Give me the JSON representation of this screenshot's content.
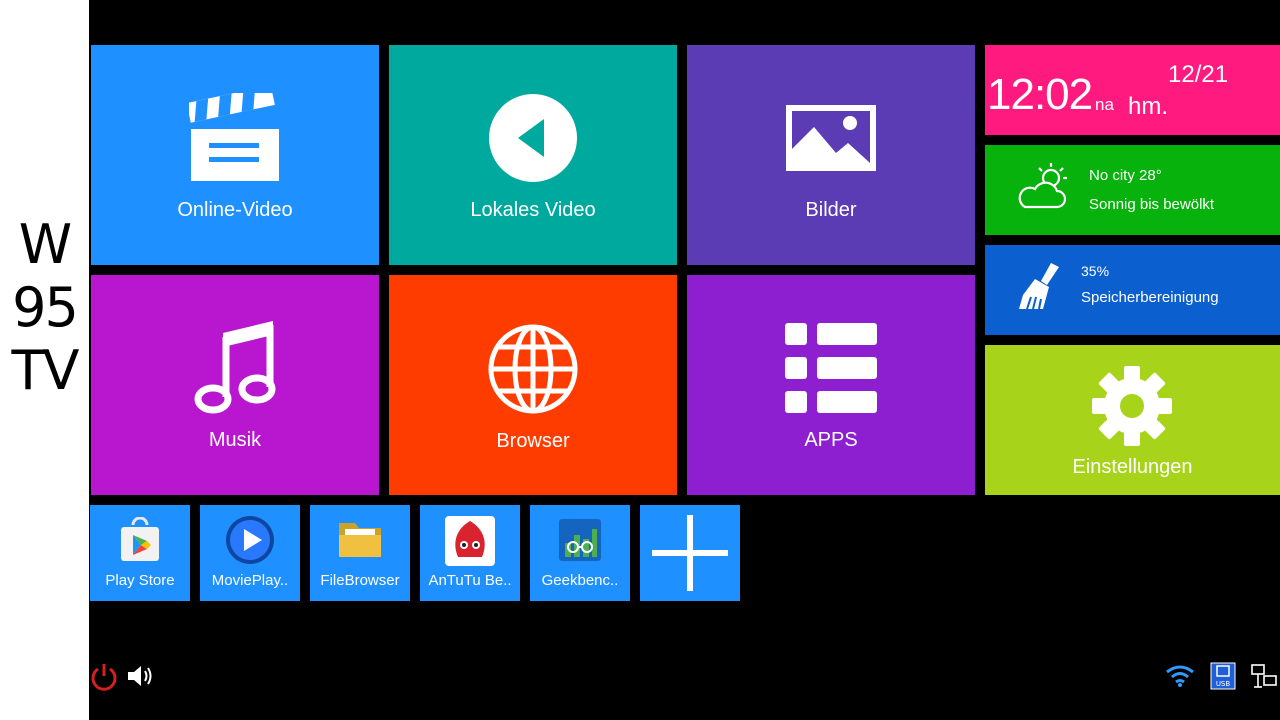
{
  "sidebar": {
    "line1": "W",
    "line2": "95",
    "line3": "TV"
  },
  "tiles": {
    "online_video": {
      "label": "Online-Video",
      "color": "#1e90ff"
    },
    "local_video": {
      "label": "Lokales Video",
      "color": "#00a99d"
    },
    "pictures": {
      "label": "Bilder",
      "color": "#5c3cb5"
    },
    "music": {
      "label": "Musik",
      "color": "#b817cf"
    },
    "browser": {
      "label": "Browser",
      "color": "#ff3c00"
    },
    "apps": {
      "label": "APPS",
      "color": "#8e1fd0"
    },
    "settings": {
      "label": "Einstellungen",
      "color": "#a7d41a"
    }
  },
  "clock": {
    "time": "12:02",
    "suffix": "na",
    "date": "12/21",
    "day": "hm.",
    "color": "#ff1a7f"
  },
  "weather": {
    "city_temp": "No city  28°",
    "condition": "Sonnig bis bewölkt",
    "color": "#07b20d"
  },
  "memory": {
    "percent": "35%",
    "label": "Speicherbereinigung",
    "color": "#0b5fcf"
  },
  "shortcuts": [
    {
      "label": "Play Store"
    },
    {
      "label": "MoviePlay.."
    },
    {
      "label": "FileBrowser"
    },
    {
      "label": "AnTuTu Be.."
    },
    {
      "label": "Geekbenc.."
    }
  ],
  "shortcut_color": "#1e90ff",
  "status": {
    "usb_label": "USB"
  }
}
